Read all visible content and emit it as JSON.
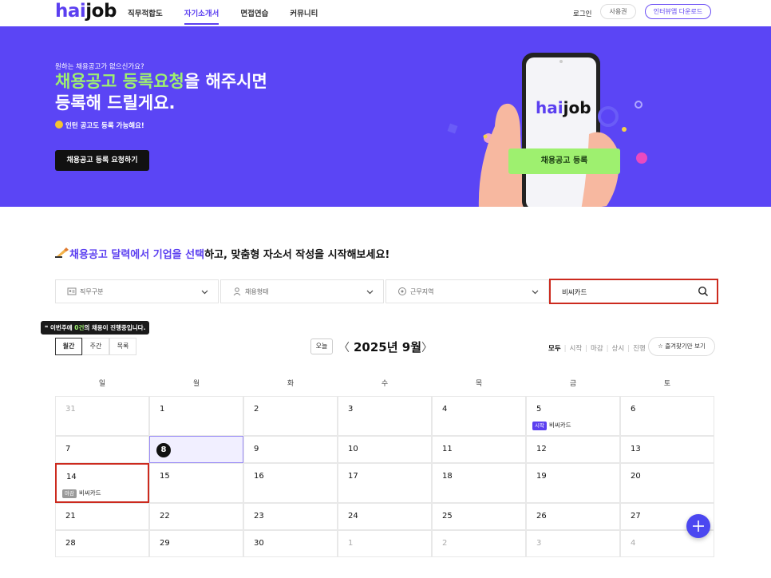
{
  "header": {
    "logo_hai": "hai",
    "logo_job": "job",
    "nav": [
      "직무적합도",
      "자기소개서",
      "면접연습",
      "커뮤니티"
    ],
    "active_nav": "자기소개서",
    "login": "로그인",
    "voucher": "사용권",
    "download": "인터뷰앱 다운로드"
  },
  "banner": {
    "small": "원하는 채용공고가 없으신가요?",
    "title_hl": "채용공고 등록요청",
    "title_rest": "을 해주시면",
    "title_line2": "등록해 드릴게요.",
    "note": "인턴 공고도 등록 가능해요!",
    "button": "채용공고 등록 요청하기",
    "phone_logo_hai": "hai",
    "phone_logo_job": "job",
    "phone_button": "채용공고 등록"
  },
  "section": {
    "title_hl": "채용공고 달력에서 기업을 선택",
    "title_rest": "하고, 맞춤형 자소서 작성을 시작해보세요!"
  },
  "filters": {
    "job": "직무구분",
    "employment": "채용형태",
    "location": "근무지역",
    "search_value": "비씨카드"
  },
  "tip": {
    "prefix": "이번주에 ",
    "count": "0건",
    "suffix": "의 채용이 진행중입니다."
  },
  "views": [
    "월간",
    "주간",
    "목록"
  ],
  "nav_month": {
    "today": "오늘",
    "prev": "〈",
    "next": "〉",
    "label": "2025년 9월"
  },
  "status_filters": [
    "모두",
    "시작",
    "마감",
    "상시",
    "진행"
  ],
  "favorite_button": "☆ 즐겨찾기만 보기",
  "weekdays": [
    "일",
    "월",
    "화",
    "수",
    "목",
    "금",
    "토"
  ],
  "weeks": [
    [
      {
        "d": "31",
        "dim": true
      },
      {
        "d": "1"
      },
      {
        "d": "2"
      },
      {
        "d": "3"
      },
      {
        "d": "4"
      },
      {
        "d": "5",
        "event": {
          "tag": "시작",
          "type": "start",
          "name": "비씨카드"
        }
      },
      {
        "d": "6"
      }
    ],
    [
      {
        "d": "7"
      },
      {
        "d": "8",
        "today": true
      },
      {
        "d": "9"
      },
      {
        "d": "10"
      },
      {
        "d": "11"
      },
      {
        "d": "12"
      },
      {
        "d": "13"
      }
    ],
    [
      {
        "d": "14",
        "highlight": true,
        "event": {
          "tag": "마감",
          "type": "end",
          "name": "비씨카드"
        }
      },
      {
        "d": "15"
      },
      {
        "d": "16"
      },
      {
        "d": "17"
      },
      {
        "d": "18"
      },
      {
        "d": "19"
      },
      {
        "d": "20"
      }
    ],
    [
      {
        "d": "21"
      },
      {
        "d": "22"
      },
      {
        "d": "23"
      },
      {
        "d": "24"
      },
      {
        "d": "25"
      },
      {
        "d": "26"
      },
      {
        "d": "27"
      }
    ],
    [
      {
        "d": "28"
      },
      {
        "d": "29"
      },
      {
        "d": "30"
      },
      {
        "d": "1",
        "dim": true
      },
      {
        "d": "2",
        "dim": true
      },
      {
        "d": "3",
        "dim": true
      },
      {
        "d": "4",
        "dim": true
      }
    ]
  ],
  "colors": {
    "brand": "#5b3ff0",
    "banner": "#5b45f5",
    "highlight_green": "#9ef06f",
    "alert_red": "#cc2a1e"
  }
}
